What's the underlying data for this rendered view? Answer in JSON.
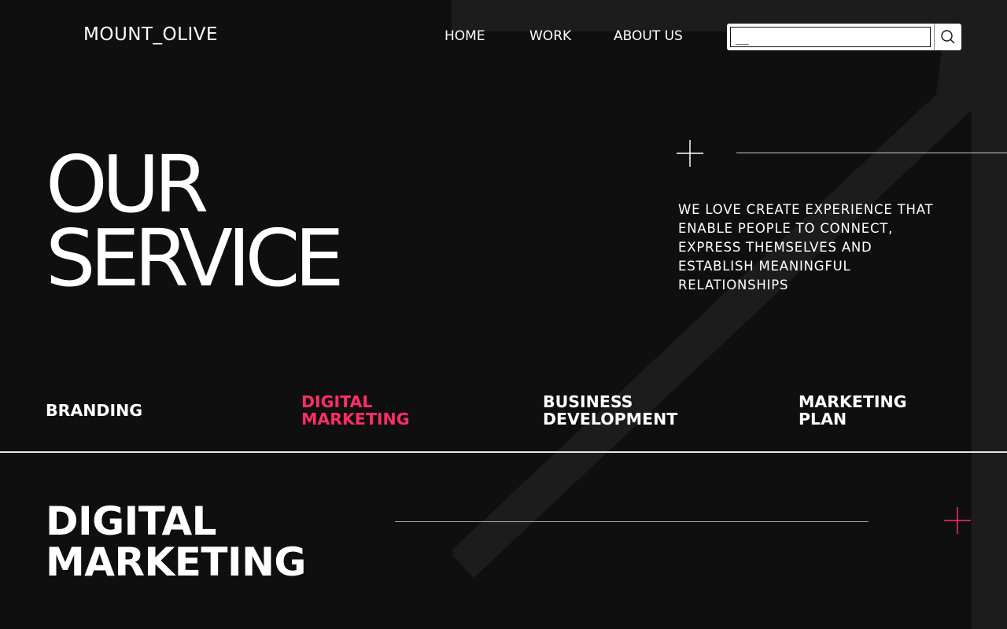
{
  "brand": {
    "logo": "MOUNT_OLIVE",
    "accent_color": "#ff2d68",
    "background_color": "#0f0f0f"
  },
  "nav": {
    "items": [
      {
        "label": "HOME"
      },
      {
        "label": "WORK"
      },
      {
        "label": "ABOUT US"
      }
    ]
  },
  "search": {
    "value": "__",
    "icon": "search-icon"
  },
  "hero": {
    "title_line1": "OUR",
    "title_line2": "SERVICE",
    "intro": "WE LOVE CREATE EXPERIENCE THAT ENABLE PEOPLE TO CONNECT, EXPRESS THEMSELVES AND ESTABLISH MEANINGFUL RELATIONSHIPS",
    "decor_icon": "plus-icon"
  },
  "services": {
    "tabs": [
      {
        "line1": "BRANDING",
        "line2": "",
        "active": false
      },
      {
        "line1": "DIGITAL",
        "line2": "MARKETING",
        "active": true
      },
      {
        "line1": "BUSINESS",
        "line2": "DEVELOPMENT",
        "active": false
      },
      {
        "line1": "MARKETING",
        "line2": "PLAN",
        "active": false
      }
    ]
  },
  "section": {
    "title_line1": "DIGITAL",
    "title_line2": "MARKETING",
    "expand_icon": "plus-icon"
  }
}
